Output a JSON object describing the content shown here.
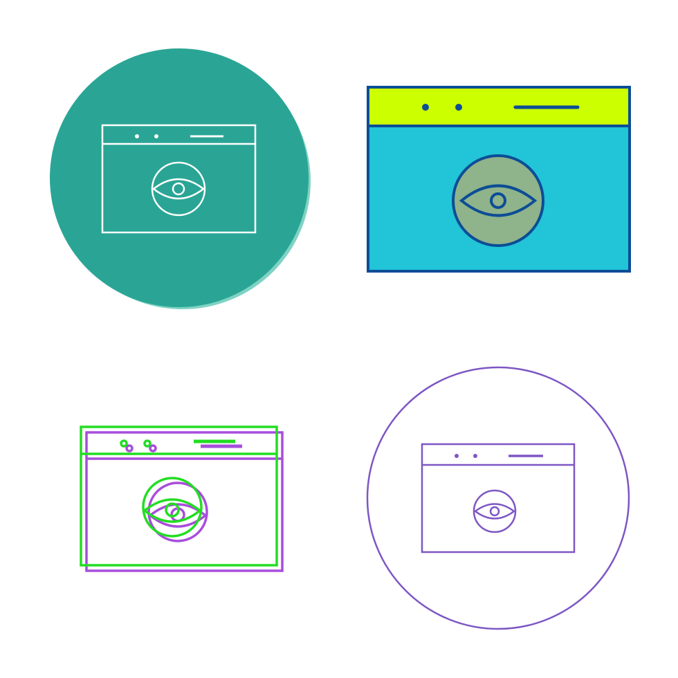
{
  "icons": [
    {
      "name": "browser-eye-icon",
      "variant": "glyph-on-teal-circle",
      "colors": {
        "background": "#2aa595",
        "highlight": "#7fd3c4",
        "stroke": "#ffffff"
      }
    },
    {
      "name": "browser-eye-icon",
      "variant": "filled-color",
      "colors": {
        "titlebar": "#ccff00",
        "body": "#22c4d8",
        "lens": "#8fb38a",
        "stroke": "#0c4d96"
      }
    },
    {
      "name": "browser-eye-icon",
      "variant": "offset-two-tone",
      "colors": {
        "primary": "#22dd22",
        "shadow": "#a74ddb"
      }
    },
    {
      "name": "browser-eye-icon",
      "variant": "outline-in-circle",
      "colors": {
        "stroke": "#7d56c4"
      }
    }
  ]
}
